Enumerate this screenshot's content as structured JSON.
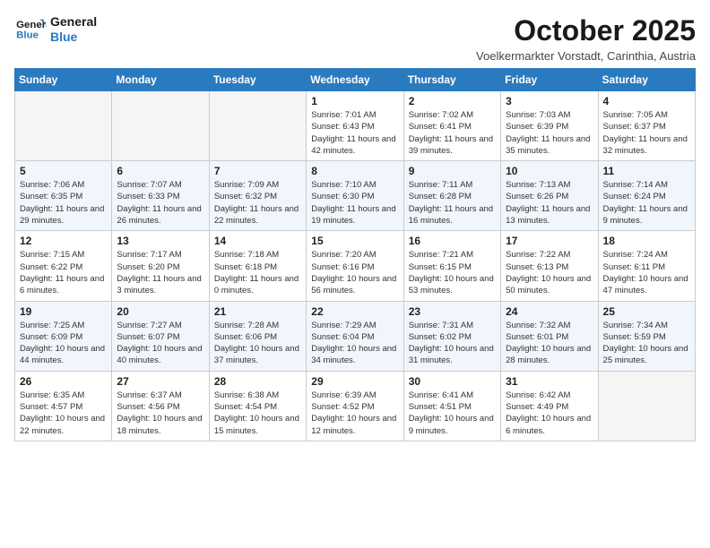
{
  "header": {
    "logo_line1": "General",
    "logo_line2": "Blue",
    "month": "October 2025",
    "location": "Voelkermarkter Vorstadt, Carinthia, Austria"
  },
  "weekdays": [
    "Sunday",
    "Monday",
    "Tuesday",
    "Wednesday",
    "Thursday",
    "Friday",
    "Saturday"
  ],
  "weeks": [
    [
      {
        "day": "",
        "info": ""
      },
      {
        "day": "",
        "info": ""
      },
      {
        "day": "",
        "info": ""
      },
      {
        "day": "1",
        "info": "Sunrise: 7:01 AM\nSunset: 6:43 PM\nDaylight: 11 hours\nand 42 minutes."
      },
      {
        "day": "2",
        "info": "Sunrise: 7:02 AM\nSunset: 6:41 PM\nDaylight: 11 hours\nand 39 minutes."
      },
      {
        "day": "3",
        "info": "Sunrise: 7:03 AM\nSunset: 6:39 PM\nDaylight: 11 hours\nand 35 minutes."
      },
      {
        "day": "4",
        "info": "Sunrise: 7:05 AM\nSunset: 6:37 PM\nDaylight: 11 hours\nand 32 minutes."
      }
    ],
    [
      {
        "day": "5",
        "info": "Sunrise: 7:06 AM\nSunset: 6:35 PM\nDaylight: 11 hours\nand 29 minutes."
      },
      {
        "day": "6",
        "info": "Sunrise: 7:07 AM\nSunset: 6:33 PM\nDaylight: 11 hours\nand 26 minutes."
      },
      {
        "day": "7",
        "info": "Sunrise: 7:09 AM\nSunset: 6:32 PM\nDaylight: 11 hours\nand 22 minutes."
      },
      {
        "day": "8",
        "info": "Sunrise: 7:10 AM\nSunset: 6:30 PM\nDaylight: 11 hours\nand 19 minutes."
      },
      {
        "day": "9",
        "info": "Sunrise: 7:11 AM\nSunset: 6:28 PM\nDaylight: 11 hours\nand 16 minutes."
      },
      {
        "day": "10",
        "info": "Sunrise: 7:13 AM\nSunset: 6:26 PM\nDaylight: 11 hours\nand 13 minutes."
      },
      {
        "day": "11",
        "info": "Sunrise: 7:14 AM\nSunset: 6:24 PM\nDaylight: 11 hours\nand 9 minutes."
      }
    ],
    [
      {
        "day": "12",
        "info": "Sunrise: 7:15 AM\nSunset: 6:22 PM\nDaylight: 11 hours\nand 6 minutes."
      },
      {
        "day": "13",
        "info": "Sunrise: 7:17 AM\nSunset: 6:20 PM\nDaylight: 11 hours\nand 3 minutes."
      },
      {
        "day": "14",
        "info": "Sunrise: 7:18 AM\nSunset: 6:18 PM\nDaylight: 11 hours\nand 0 minutes."
      },
      {
        "day": "15",
        "info": "Sunrise: 7:20 AM\nSunset: 6:16 PM\nDaylight: 10 hours\nand 56 minutes."
      },
      {
        "day": "16",
        "info": "Sunrise: 7:21 AM\nSunset: 6:15 PM\nDaylight: 10 hours\nand 53 minutes."
      },
      {
        "day": "17",
        "info": "Sunrise: 7:22 AM\nSunset: 6:13 PM\nDaylight: 10 hours\nand 50 minutes."
      },
      {
        "day": "18",
        "info": "Sunrise: 7:24 AM\nSunset: 6:11 PM\nDaylight: 10 hours\nand 47 minutes."
      }
    ],
    [
      {
        "day": "19",
        "info": "Sunrise: 7:25 AM\nSunset: 6:09 PM\nDaylight: 10 hours\nand 44 minutes."
      },
      {
        "day": "20",
        "info": "Sunrise: 7:27 AM\nSunset: 6:07 PM\nDaylight: 10 hours\nand 40 minutes."
      },
      {
        "day": "21",
        "info": "Sunrise: 7:28 AM\nSunset: 6:06 PM\nDaylight: 10 hours\nand 37 minutes."
      },
      {
        "day": "22",
        "info": "Sunrise: 7:29 AM\nSunset: 6:04 PM\nDaylight: 10 hours\nand 34 minutes."
      },
      {
        "day": "23",
        "info": "Sunrise: 7:31 AM\nSunset: 6:02 PM\nDaylight: 10 hours\nand 31 minutes."
      },
      {
        "day": "24",
        "info": "Sunrise: 7:32 AM\nSunset: 6:01 PM\nDaylight: 10 hours\nand 28 minutes."
      },
      {
        "day": "25",
        "info": "Sunrise: 7:34 AM\nSunset: 5:59 PM\nDaylight: 10 hours\nand 25 minutes."
      }
    ],
    [
      {
        "day": "26",
        "info": "Sunrise: 6:35 AM\nSunset: 4:57 PM\nDaylight: 10 hours\nand 22 minutes."
      },
      {
        "day": "27",
        "info": "Sunrise: 6:37 AM\nSunset: 4:56 PM\nDaylight: 10 hours\nand 18 minutes."
      },
      {
        "day": "28",
        "info": "Sunrise: 6:38 AM\nSunset: 4:54 PM\nDaylight: 10 hours\nand 15 minutes."
      },
      {
        "day": "29",
        "info": "Sunrise: 6:39 AM\nSunset: 4:52 PM\nDaylight: 10 hours\nand 12 minutes."
      },
      {
        "day": "30",
        "info": "Sunrise: 6:41 AM\nSunset: 4:51 PM\nDaylight: 10 hours\nand 9 minutes."
      },
      {
        "day": "31",
        "info": "Sunrise: 6:42 AM\nSunset: 4:49 PM\nDaylight: 10 hours\nand 6 minutes."
      },
      {
        "day": "",
        "info": ""
      }
    ]
  ]
}
